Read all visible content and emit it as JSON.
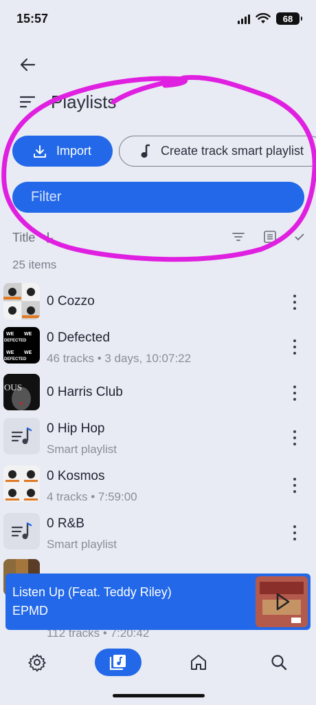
{
  "status": {
    "time": "15:57",
    "battery": "68"
  },
  "header": {
    "title": "Playlists"
  },
  "actions": {
    "import_label": "Import",
    "smart_label": "Create track smart playlist"
  },
  "filter": {
    "placeholder": "Filter"
  },
  "sort": {
    "label": "Title"
  },
  "count": "25 items",
  "playlists": [
    {
      "title": "0 Cozzo",
      "subtitle": ""
    },
    {
      "title": "0 Defected",
      "subtitle": "46 tracks • 3 days, 10:07:22"
    },
    {
      "title": "0 Harris Club",
      "subtitle": ""
    },
    {
      "title": "0 Hip Hop",
      "subtitle": "Smart playlist"
    },
    {
      "title": "0 Kosmos",
      "subtitle": "4 tracks • 7:59:00"
    },
    {
      "title": "0 R&B",
      "subtitle": "Smart playlist"
    },
    {
      "title": "",
      "subtitle": "112 tracks • 7:20:42"
    }
  ],
  "now_playing": {
    "title": "Listen Up (Feat. Teddy Riley)",
    "artist": "EPMD"
  },
  "colors": {
    "accent": "#2268e8",
    "background": "#e9ebf4",
    "annotation": "#e020e0"
  },
  "icons": {
    "back": "back-arrow-icon",
    "menu": "menu-icon",
    "import": "download-icon",
    "music": "music-note-icon",
    "sort": "sort-arrow-icon",
    "filter": "filter-lines-icon",
    "list": "list-view-icon",
    "check": "checklist-icon",
    "more": "more-vert-icon",
    "settings": "gear-icon",
    "library": "library-music-icon",
    "home": "home-icon",
    "search": "search-icon",
    "play": "play-icon"
  }
}
